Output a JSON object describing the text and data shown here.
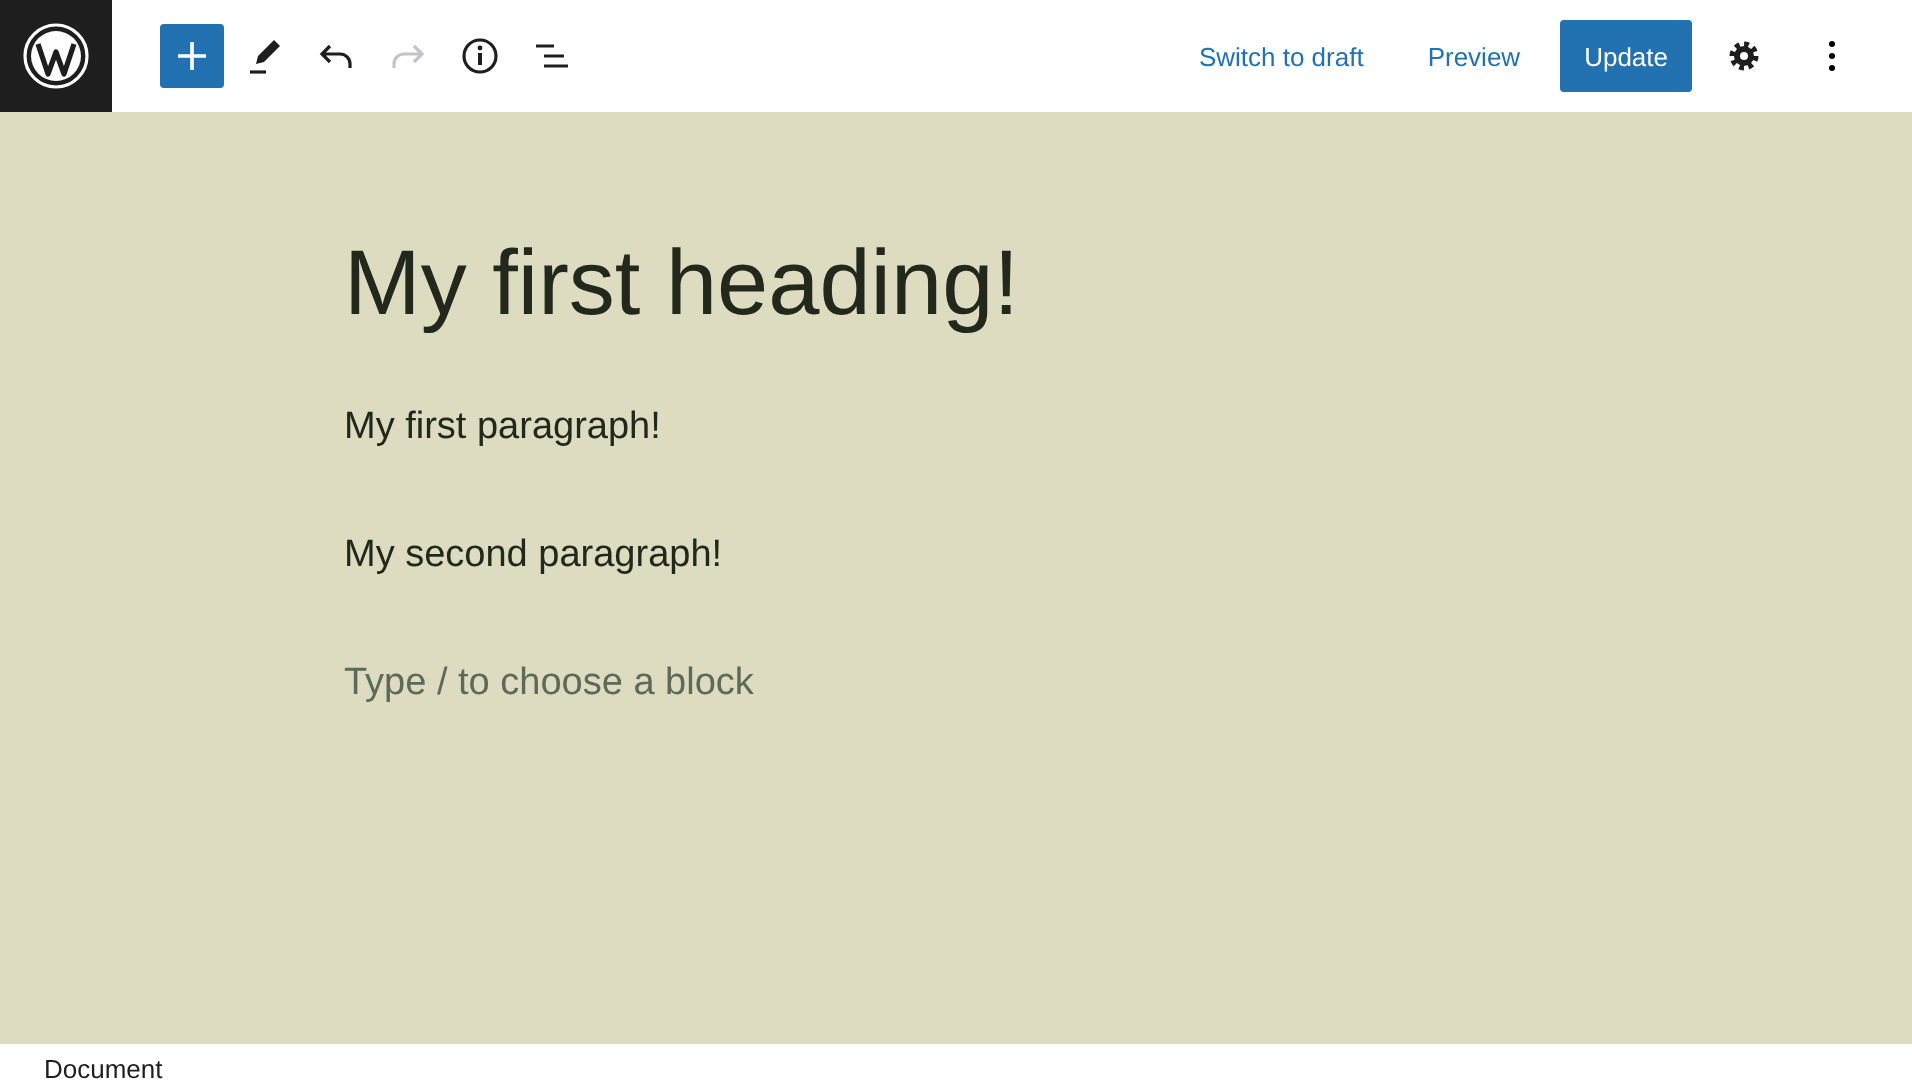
{
  "toolbar": {
    "tools": [
      {
        "kind": "inserter",
        "disabled": false
      },
      {
        "kind": "edit",
        "disabled": false
      },
      {
        "kind": "undo",
        "disabled": false
      },
      {
        "kind": "redo",
        "disabled": true
      },
      {
        "kind": "info",
        "disabled": false
      },
      {
        "kind": "outline",
        "disabled": false
      }
    ],
    "actions": [
      {
        "kind": "link",
        "label": "Switch to draft"
      },
      {
        "kind": "link",
        "label": "Preview"
      },
      {
        "kind": "primary",
        "label": "Update"
      }
    ]
  },
  "blocks": [
    {
      "kind": "heading",
      "text": "My first heading!"
    },
    {
      "kind": "paragraph",
      "text": "My first paragraph!"
    },
    {
      "kind": "paragraph",
      "text": "My second paragraph!"
    }
  ],
  "appender": {
    "placeholder": "Type / to choose a block"
  },
  "footer": {
    "breadcrumb": "Document"
  }
}
